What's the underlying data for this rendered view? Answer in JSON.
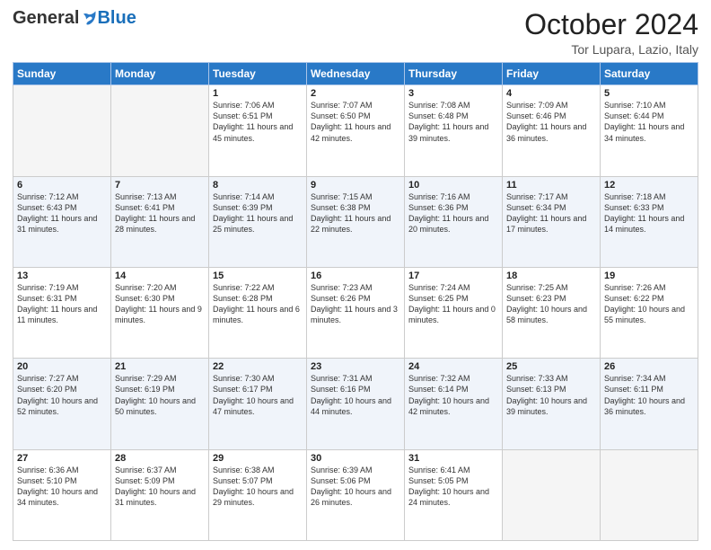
{
  "header": {
    "logo_general": "General",
    "logo_blue": "Blue",
    "month": "October 2024",
    "location": "Tor Lupara, Lazio, Italy"
  },
  "days_of_week": [
    "Sunday",
    "Monday",
    "Tuesday",
    "Wednesday",
    "Thursday",
    "Friday",
    "Saturday"
  ],
  "weeks": [
    [
      {
        "day": "",
        "info": ""
      },
      {
        "day": "",
        "info": ""
      },
      {
        "day": "1",
        "info": "Sunrise: 7:06 AM\nSunset: 6:51 PM\nDaylight: 11 hours and 45 minutes."
      },
      {
        "day": "2",
        "info": "Sunrise: 7:07 AM\nSunset: 6:50 PM\nDaylight: 11 hours and 42 minutes."
      },
      {
        "day": "3",
        "info": "Sunrise: 7:08 AM\nSunset: 6:48 PM\nDaylight: 11 hours and 39 minutes."
      },
      {
        "day": "4",
        "info": "Sunrise: 7:09 AM\nSunset: 6:46 PM\nDaylight: 11 hours and 36 minutes."
      },
      {
        "day": "5",
        "info": "Sunrise: 7:10 AM\nSunset: 6:44 PM\nDaylight: 11 hours and 34 minutes."
      }
    ],
    [
      {
        "day": "6",
        "info": "Sunrise: 7:12 AM\nSunset: 6:43 PM\nDaylight: 11 hours and 31 minutes."
      },
      {
        "day": "7",
        "info": "Sunrise: 7:13 AM\nSunset: 6:41 PM\nDaylight: 11 hours and 28 minutes."
      },
      {
        "day": "8",
        "info": "Sunrise: 7:14 AM\nSunset: 6:39 PM\nDaylight: 11 hours and 25 minutes."
      },
      {
        "day": "9",
        "info": "Sunrise: 7:15 AM\nSunset: 6:38 PM\nDaylight: 11 hours and 22 minutes."
      },
      {
        "day": "10",
        "info": "Sunrise: 7:16 AM\nSunset: 6:36 PM\nDaylight: 11 hours and 20 minutes."
      },
      {
        "day": "11",
        "info": "Sunrise: 7:17 AM\nSunset: 6:34 PM\nDaylight: 11 hours and 17 minutes."
      },
      {
        "day": "12",
        "info": "Sunrise: 7:18 AM\nSunset: 6:33 PM\nDaylight: 11 hours and 14 minutes."
      }
    ],
    [
      {
        "day": "13",
        "info": "Sunrise: 7:19 AM\nSunset: 6:31 PM\nDaylight: 11 hours and 11 minutes."
      },
      {
        "day": "14",
        "info": "Sunrise: 7:20 AM\nSunset: 6:30 PM\nDaylight: 11 hours and 9 minutes."
      },
      {
        "day": "15",
        "info": "Sunrise: 7:22 AM\nSunset: 6:28 PM\nDaylight: 11 hours and 6 minutes."
      },
      {
        "day": "16",
        "info": "Sunrise: 7:23 AM\nSunset: 6:26 PM\nDaylight: 11 hours and 3 minutes."
      },
      {
        "day": "17",
        "info": "Sunrise: 7:24 AM\nSunset: 6:25 PM\nDaylight: 11 hours and 0 minutes."
      },
      {
        "day": "18",
        "info": "Sunrise: 7:25 AM\nSunset: 6:23 PM\nDaylight: 10 hours and 58 minutes."
      },
      {
        "day": "19",
        "info": "Sunrise: 7:26 AM\nSunset: 6:22 PM\nDaylight: 10 hours and 55 minutes."
      }
    ],
    [
      {
        "day": "20",
        "info": "Sunrise: 7:27 AM\nSunset: 6:20 PM\nDaylight: 10 hours and 52 minutes."
      },
      {
        "day": "21",
        "info": "Sunrise: 7:29 AM\nSunset: 6:19 PM\nDaylight: 10 hours and 50 minutes."
      },
      {
        "day": "22",
        "info": "Sunrise: 7:30 AM\nSunset: 6:17 PM\nDaylight: 10 hours and 47 minutes."
      },
      {
        "day": "23",
        "info": "Sunrise: 7:31 AM\nSunset: 6:16 PM\nDaylight: 10 hours and 44 minutes."
      },
      {
        "day": "24",
        "info": "Sunrise: 7:32 AM\nSunset: 6:14 PM\nDaylight: 10 hours and 42 minutes."
      },
      {
        "day": "25",
        "info": "Sunrise: 7:33 AM\nSunset: 6:13 PM\nDaylight: 10 hours and 39 minutes."
      },
      {
        "day": "26",
        "info": "Sunrise: 7:34 AM\nSunset: 6:11 PM\nDaylight: 10 hours and 36 minutes."
      }
    ],
    [
      {
        "day": "27",
        "info": "Sunrise: 6:36 AM\nSunset: 5:10 PM\nDaylight: 10 hours and 34 minutes."
      },
      {
        "day": "28",
        "info": "Sunrise: 6:37 AM\nSunset: 5:09 PM\nDaylight: 10 hours and 31 minutes."
      },
      {
        "day": "29",
        "info": "Sunrise: 6:38 AM\nSunset: 5:07 PM\nDaylight: 10 hours and 29 minutes."
      },
      {
        "day": "30",
        "info": "Sunrise: 6:39 AM\nSunset: 5:06 PM\nDaylight: 10 hours and 26 minutes."
      },
      {
        "day": "31",
        "info": "Sunrise: 6:41 AM\nSunset: 5:05 PM\nDaylight: 10 hours and 24 minutes."
      },
      {
        "day": "",
        "info": ""
      },
      {
        "day": "",
        "info": ""
      }
    ]
  ]
}
